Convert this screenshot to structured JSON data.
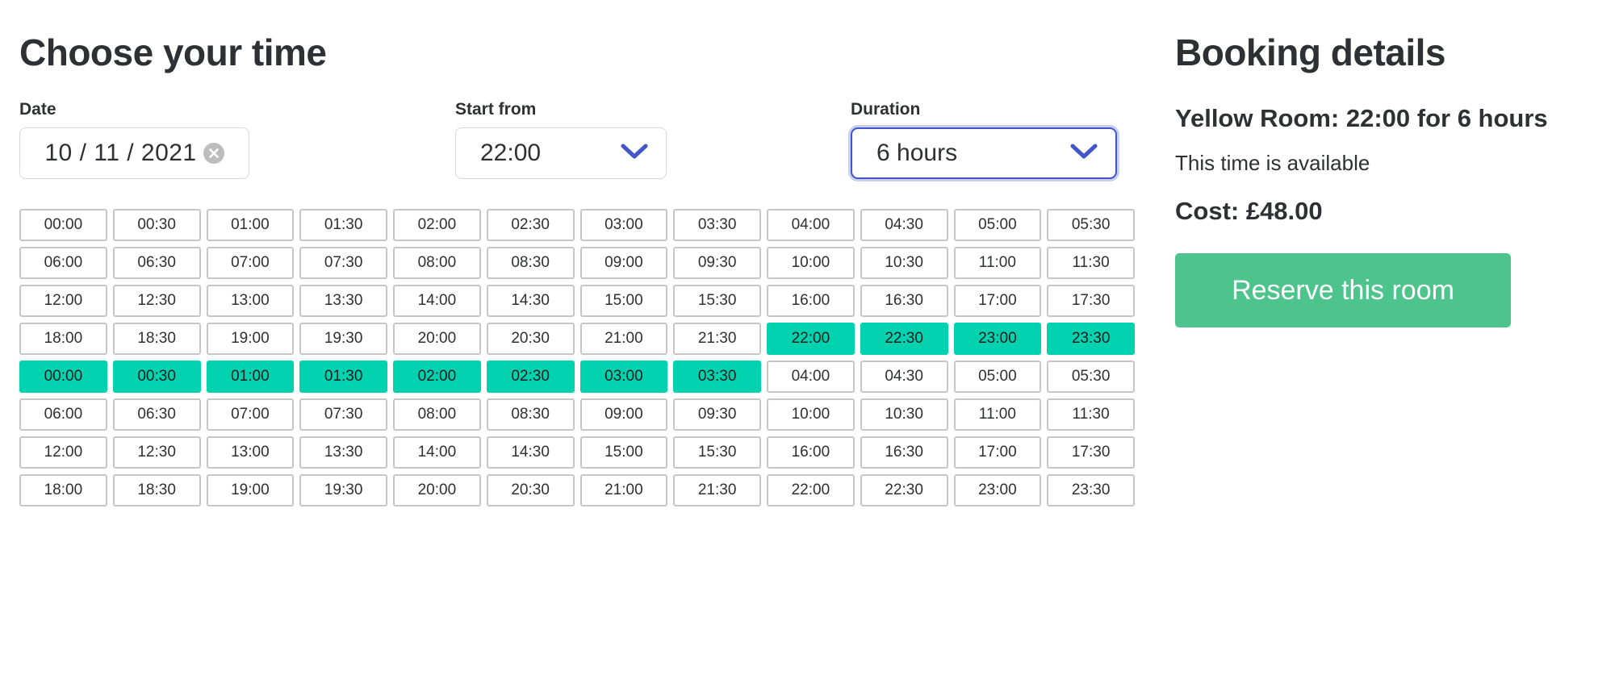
{
  "left": {
    "title": "Choose your time",
    "fields": {
      "date": {
        "label": "Date",
        "value": "10 / 11 / 2021",
        "clear_icon": "clear-circle-icon"
      },
      "start_from": {
        "label": "Start from",
        "value": "22:00",
        "chevron_icon": "chevron-down-icon"
      },
      "duration": {
        "label": "Duration",
        "value": "6 hours",
        "chevron_icon": "chevron-down-icon",
        "focused": true
      }
    },
    "grid": {
      "columns": 12,
      "rows": [
        {
          "slots": [
            {
              "time": "00:00",
              "selected": false
            },
            {
              "time": "00:30",
              "selected": false
            },
            {
              "time": "01:00",
              "selected": false
            },
            {
              "time": "01:30",
              "selected": false
            },
            {
              "time": "02:00",
              "selected": false
            },
            {
              "time": "02:30",
              "selected": false
            },
            {
              "time": "03:00",
              "selected": false
            },
            {
              "time": "03:30",
              "selected": false
            },
            {
              "time": "04:00",
              "selected": false
            },
            {
              "time": "04:30",
              "selected": false
            },
            {
              "time": "05:00",
              "selected": false
            },
            {
              "time": "05:30",
              "selected": false
            }
          ]
        },
        {
          "slots": [
            {
              "time": "06:00",
              "selected": false
            },
            {
              "time": "06:30",
              "selected": false
            },
            {
              "time": "07:00",
              "selected": false
            },
            {
              "time": "07:30",
              "selected": false
            },
            {
              "time": "08:00",
              "selected": false
            },
            {
              "time": "08:30",
              "selected": false
            },
            {
              "time": "09:00",
              "selected": false
            },
            {
              "time": "09:30",
              "selected": false
            },
            {
              "time": "10:00",
              "selected": false
            },
            {
              "time": "10:30",
              "selected": false
            },
            {
              "time": "11:00",
              "selected": false
            },
            {
              "time": "11:30",
              "selected": false
            }
          ]
        },
        {
          "slots": [
            {
              "time": "12:00",
              "selected": false
            },
            {
              "time": "12:30",
              "selected": false
            },
            {
              "time": "13:00",
              "selected": false
            },
            {
              "time": "13:30",
              "selected": false
            },
            {
              "time": "14:00",
              "selected": false
            },
            {
              "time": "14:30",
              "selected": false
            },
            {
              "time": "15:00",
              "selected": false
            },
            {
              "time": "15:30",
              "selected": false
            },
            {
              "time": "16:00",
              "selected": false
            },
            {
              "time": "16:30",
              "selected": false
            },
            {
              "time": "17:00",
              "selected": false
            },
            {
              "time": "17:30",
              "selected": false
            }
          ]
        },
        {
          "slots": [
            {
              "time": "18:00",
              "selected": false
            },
            {
              "time": "18:30",
              "selected": false
            },
            {
              "time": "19:00",
              "selected": false
            },
            {
              "time": "19:30",
              "selected": false
            },
            {
              "time": "20:00",
              "selected": false
            },
            {
              "time": "20:30",
              "selected": false
            },
            {
              "time": "21:00",
              "selected": false
            },
            {
              "time": "21:30",
              "selected": false
            },
            {
              "time": "22:00",
              "selected": true
            },
            {
              "time": "22:30",
              "selected": true
            },
            {
              "time": "23:00",
              "selected": true
            },
            {
              "time": "23:30",
              "selected": true
            }
          ]
        },
        {
          "slots": [
            {
              "time": "00:00",
              "selected": true
            },
            {
              "time": "00:30",
              "selected": true
            },
            {
              "time": "01:00",
              "selected": true
            },
            {
              "time": "01:30",
              "selected": true
            },
            {
              "time": "02:00",
              "selected": true
            },
            {
              "time": "02:30",
              "selected": true
            },
            {
              "time": "03:00",
              "selected": true
            },
            {
              "time": "03:30",
              "selected": true
            },
            {
              "time": "04:00",
              "selected": false
            },
            {
              "time": "04:30",
              "selected": false
            },
            {
              "time": "05:00",
              "selected": false
            },
            {
              "time": "05:30",
              "selected": false
            }
          ]
        },
        {
          "slots": [
            {
              "time": "06:00",
              "selected": false
            },
            {
              "time": "06:30",
              "selected": false
            },
            {
              "time": "07:00",
              "selected": false
            },
            {
              "time": "07:30",
              "selected": false
            },
            {
              "time": "08:00",
              "selected": false
            },
            {
              "time": "08:30",
              "selected": false
            },
            {
              "time": "09:00",
              "selected": false
            },
            {
              "time": "09:30",
              "selected": false
            },
            {
              "time": "10:00",
              "selected": false
            },
            {
              "time": "10:30",
              "selected": false
            },
            {
              "time": "11:00",
              "selected": false
            },
            {
              "time": "11:30",
              "selected": false
            }
          ]
        },
        {
          "slots": [
            {
              "time": "12:00",
              "selected": false
            },
            {
              "time": "12:30",
              "selected": false
            },
            {
              "time": "13:00",
              "selected": false
            },
            {
              "time": "13:30",
              "selected": false
            },
            {
              "time": "14:00",
              "selected": false
            },
            {
              "time": "14:30",
              "selected": false
            },
            {
              "time": "15:00",
              "selected": false
            },
            {
              "time": "15:30",
              "selected": false
            },
            {
              "time": "16:00",
              "selected": false
            },
            {
              "time": "16:30",
              "selected": false
            },
            {
              "time": "17:00",
              "selected": false
            },
            {
              "time": "17:30",
              "selected": false
            }
          ]
        },
        {
          "slots": [
            {
              "time": "18:00",
              "selected": false
            },
            {
              "time": "18:30",
              "selected": false
            },
            {
              "time": "19:00",
              "selected": false
            },
            {
              "time": "19:30",
              "selected": false
            },
            {
              "time": "20:00",
              "selected": false
            },
            {
              "time": "20:30",
              "selected": false
            },
            {
              "time": "21:00",
              "selected": false
            },
            {
              "time": "21:30",
              "selected": false
            },
            {
              "time": "22:00",
              "selected": false
            },
            {
              "time": "22:30",
              "selected": false
            },
            {
              "time": "23:00",
              "selected": false
            },
            {
              "time": "23:30",
              "selected": false
            }
          ]
        }
      ]
    }
  },
  "right": {
    "title": "Booking details",
    "summary": "Yellow Room: 22:00 for 6 hours",
    "availability": "This time is available",
    "cost": "Cost: £48.00",
    "reserve_label": "Reserve this room"
  },
  "colors": {
    "selected_slot": "#00d2b0",
    "reserve_button": "#4dc48c",
    "focus_ring": "#4256c9",
    "chevron": "#4256c9",
    "slot_border": "#c6c6c6",
    "text": "#2f3033"
  }
}
